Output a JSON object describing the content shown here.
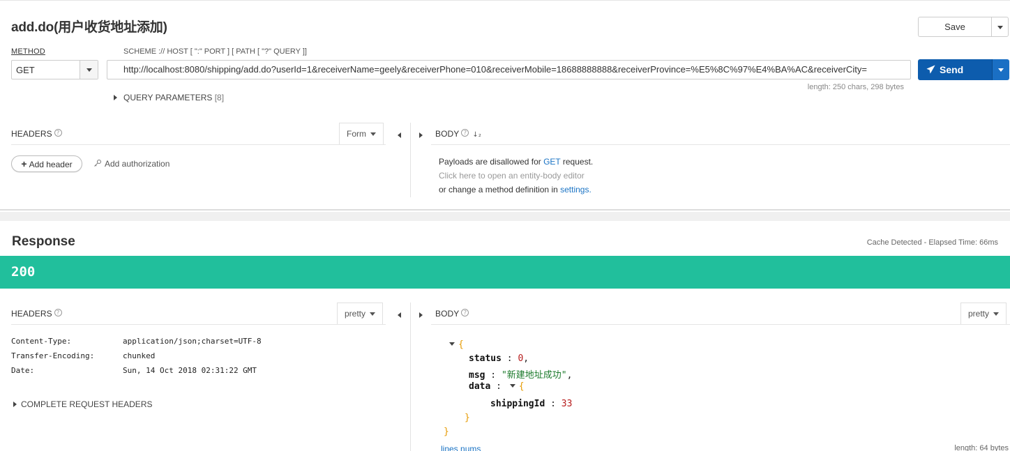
{
  "request": {
    "title": "add.do(用户收货地址添加)",
    "save_label": "Save",
    "method_label": "METHOD",
    "scheme_label": "SCHEME :// HOST [ \":\" PORT ] [ PATH [ \"?\" QUERY ]]",
    "method_value": "GET",
    "url": "http://localhost:8080/shipping/add.do?userId=1&receiverName=geely&receiverPhone=010&receiverMobile=18688888888&receiverProvince=%E5%8C%97%E4%BA%AC&receiverCity=",
    "url_length": "length: 250 chars, 298 bytes",
    "send_label": "Send",
    "query_params_label": "QUERY PARAMETERS",
    "query_params_count": "[8]",
    "headers_label": "HEADERS",
    "headers_mode": "Form",
    "body_label": "BODY",
    "add_header_label": "Add header",
    "add_auth_label": "Add authorization",
    "body_msg": {
      "line1_prefix": "Payloads are disallowed for ",
      "line1_method": "GET",
      "line1_suffix": " request.",
      "line2": "Click here to open an entity-body editor",
      "line3_prefix": "or change a method definition in ",
      "line3_link": "settings",
      "line3_suffix": "."
    }
  },
  "response": {
    "title": "Response",
    "cache_info": "Cache Detected - Elapsed Time: 66ms",
    "status_code": "200",
    "headers_label": "HEADERS",
    "headers_mode": "pretty",
    "body_label": "BODY",
    "body_mode": "pretty",
    "headers": [
      {
        "name": "Content-Type:",
        "value": "application/json;charset=UTF-8"
      },
      {
        "name": "Transfer-Encoding:",
        "value": "chunked"
      },
      {
        "name": "Date:",
        "value": "Sun, 14 Oct 2018 02:31:22 GMT"
      }
    ],
    "complete_headers_label": "COMPLETE REQUEST HEADERS",
    "json": {
      "open": "{",
      "status_key": "status",
      "status_val": "0",
      "msg_key": "msg",
      "msg_val": "\"新建地址成功\"",
      "data_key": "data",
      "data_open": "{",
      "shipping_key": "shippingId",
      "shipping_val": "33",
      "data_close": "}",
      "close": "}"
    },
    "lines_nums_label": "lines nums",
    "body_length": "length: 64 bytes"
  },
  "colors": {
    "status_ok": "#21bf9c",
    "send_button": "#0d5cad",
    "link": "#1a73c4"
  }
}
